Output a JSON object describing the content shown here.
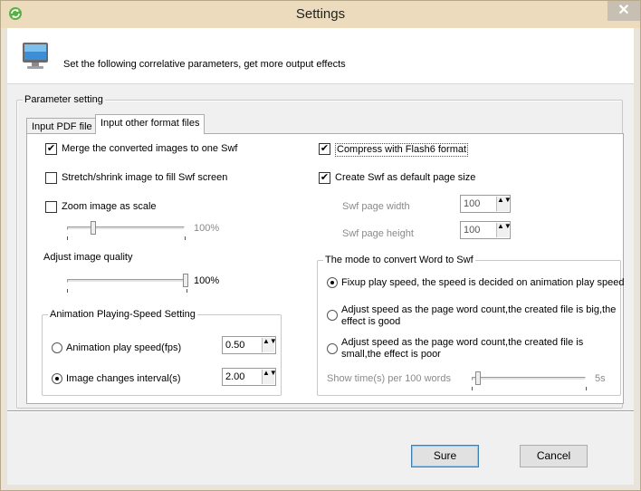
{
  "window": {
    "title": "Settings",
    "close_glyph": "✕"
  },
  "header": {
    "description": "Set the following correlative parameters, get more output effects"
  },
  "parameter_group": {
    "legend": "Parameter setting"
  },
  "tabs": [
    {
      "label": "Input PDF file",
      "active": false
    },
    {
      "label": "Input other format files",
      "active": true
    }
  ],
  "left": {
    "merge_images": {
      "label": "Merge the converted images to one Swf",
      "checked": true
    },
    "stretch_image": {
      "label": "Stretch/shrink image to fill Swf screen",
      "checked": false
    },
    "zoom_image": {
      "label": "Zoom image as scale",
      "checked": false
    },
    "zoom_slider": {
      "value_label": "100%",
      "enabled": false
    },
    "quality_label": "Adjust image quality",
    "quality_slider": {
      "value_label": "100%"
    },
    "speed_group": {
      "legend": "Animation Playing-Speed Setting",
      "play_speed": {
        "label": "Animation play speed(fps)",
        "value": "0.50",
        "selected": false
      },
      "change_interval": {
        "label": "Image changes interval(s)",
        "value": "2.00",
        "selected": true
      }
    }
  },
  "right": {
    "compress_flash6": {
      "label": "Compress with Flash6 format",
      "checked": true
    },
    "default_page_size": {
      "label": "Create Swf as default page size",
      "checked": true
    },
    "page_width": {
      "label": "Swf page width",
      "value": "100"
    },
    "page_height": {
      "label": "Swf page height",
      "value": "100"
    },
    "word_mode_group": {
      "legend": "The mode to convert Word to Swf",
      "option1": {
        "label": "Fixup play speed, the speed is decided on animation play speed",
        "selected": true
      },
      "option2": {
        "label_line1": "Adjust speed as the page word count,the created file is big,the",
        "label_line2": "effect is good",
        "selected": false
      },
      "option3": {
        "label_line1": "Adjust speed as the page word count,the created file is",
        "label_line2": "small,the effect is poor",
        "selected": false
      },
      "show_time": {
        "label": "Show time(s) per 100 words",
        "value_label": "5s"
      }
    }
  },
  "buttons": {
    "ok": "Sure",
    "cancel": "Cancel"
  },
  "spin_arrows": "▲▼",
  "check_glyph": "✔"
}
